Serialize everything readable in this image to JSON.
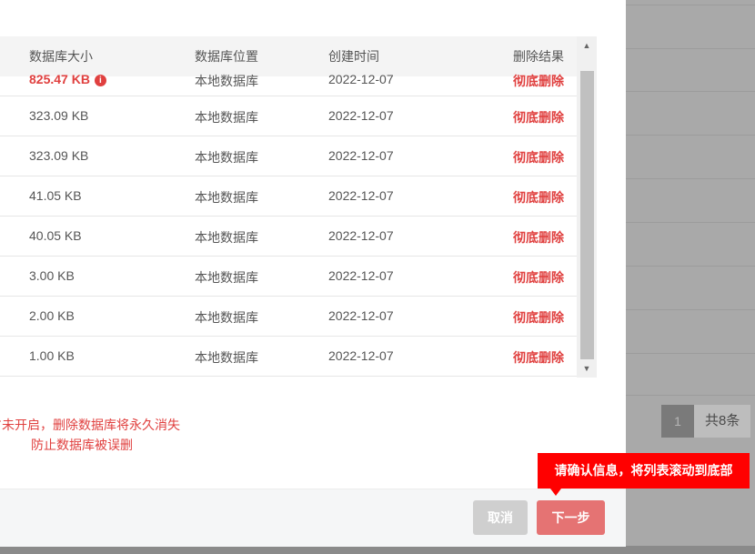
{
  "table": {
    "headers": {
      "size": "数据库大小",
      "location": "数据库位置",
      "created": "创建时间",
      "result": "删除结果"
    },
    "rows": [
      {
        "size": "825.47 KB",
        "location": "本地数据库",
        "created": "2022-12-07",
        "result": "彻底删除"
      },
      {
        "size": "323.09 KB",
        "location": "本地数据库",
        "created": "2022-12-07",
        "result": "彻底删除"
      },
      {
        "size": "323.09 KB",
        "location": "本地数据库",
        "created": "2022-12-07",
        "result": "彻底删除"
      },
      {
        "size": "41.05 KB",
        "location": "本地数据库",
        "created": "2022-12-07",
        "result": "彻底删除"
      },
      {
        "size": "40.05 KB",
        "location": "本地数据库",
        "created": "2022-12-07",
        "result": "彻底删除"
      },
      {
        "size": "3.00 KB",
        "location": "本地数据库",
        "created": "2022-12-07",
        "result": "彻底删除"
      },
      {
        "size": "2.00 KB",
        "location": "本地数据库",
        "created": "2022-12-07",
        "result": "彻底删除"
      },
      {
        "size": "1.00 KB",
        "location": "本地数据库",
        "created": "2022-12-07",
        "result": "彻底删除"
      }
    ],
    "info_icon": "i"
  },
  "scrollbar": {
    "up": "▲",
    "down": "▼"
  },
  "warning": {
    "line1": "占未开启，删除数据库将永久消失",
    "line2": "防止数据库被误删"
  },
  "buttons": {
    "cancel": "取消",
    "next": "下一步"
  },
  "tooltip": "请确认信息，将列表滚动到底部",
  "background": {
    "page_num": "1",
    "total": "共8条"
  },
  "colors": {
    "danger": "#e0403f",
    "tooltip": "#ff0000",
    "next_button": "#e57373"
  }
}
